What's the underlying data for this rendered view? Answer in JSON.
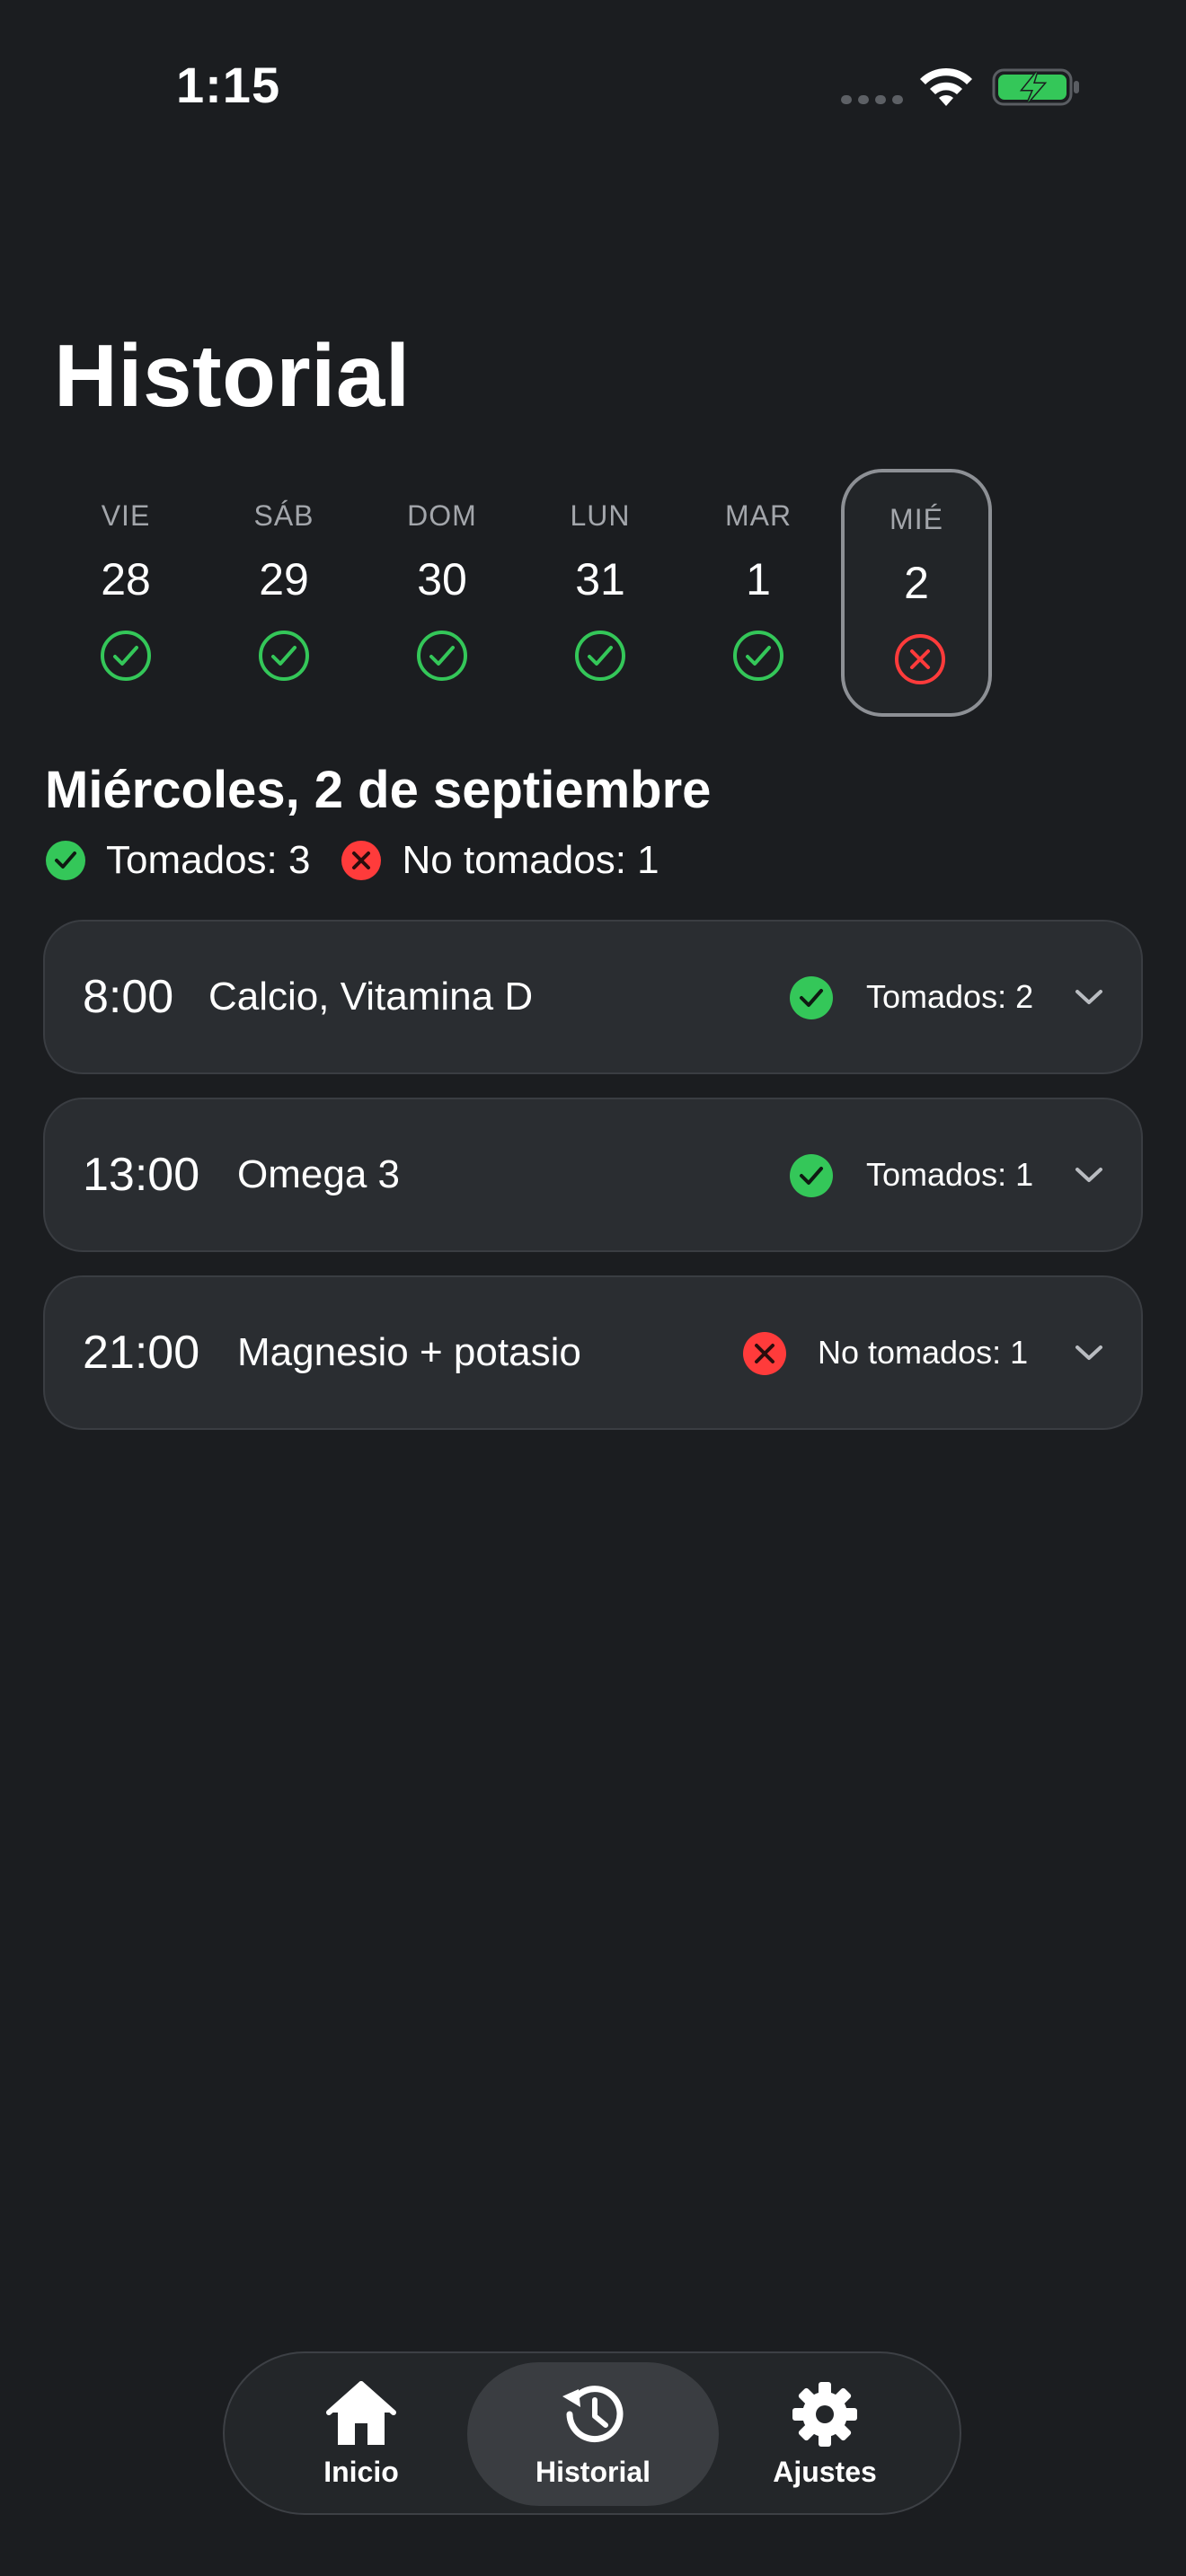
{
  "status_bar": {
    "time": "1:15"
  },
  "header": {
    "title": "Historial"
  },
  "days": [
    {
      "abbr": "VIE",
      "num": "28",
      "status": "taken",
      "selected": false
    },
    {
      "abbr": "SÁB",
      "num": "29",
      "status": "taken",
      "selected": false
    },
    {
      "abbr": "DOM",
      "num": "30",
      "status": "taken",
      "selected": false
    },
    {
      "abbr": "LUN",
      "num": "31",
      "status": "taken",
      "selected": false
    },
    {
      "abbr": "MAR",
      "num": "1",
      "status": "taken",
      "selected": false
    },
    {
      "abbr": "MIÉ",
      "num": "2",
      "status": "missed",
      "selected": true
    }
  ],
  "selected_day": {
    "heading": "Miércoles, 2 de septiembre",
    "taken_summary": "Tomados: 3",
    "missed_summary": "No tomados: 1"
  },
  "doses": [
    {
      "time": "8:00",
      "name": "Calcio, Vitamina D",
      "status": "taken",
      "status_text": "Tomados: 2"
    },
    {
      "time": "13:00",
      "name": "Omega 3",
      "status": "taken",
      "status_text": "Tomados: 1"
    },
    {
      "time": "21:00",
      "name": "Magnesio + potasio",
      "status": "missed",
      "status_text": "No tomados: 1"
    }
  ],
  "tabs": [
    {
      "label": "Inicio",
      "icon": "home-icon",
      "active": false
    },
    {
      "label": "Historial",
      "icon": "history-icon",
      "active": true
    },
    {
      "label": "Ajustes",
      "icon": "gear-icon",
      "active": false
    }
  ],
  "colors": {
    "background": "#1b1d20",
    "card": "#2a2d31",
    "taken": "#34c759",
    "missed": "#ff3b3b",
    "text_secondary": "#a3a6ab"
  }
}
